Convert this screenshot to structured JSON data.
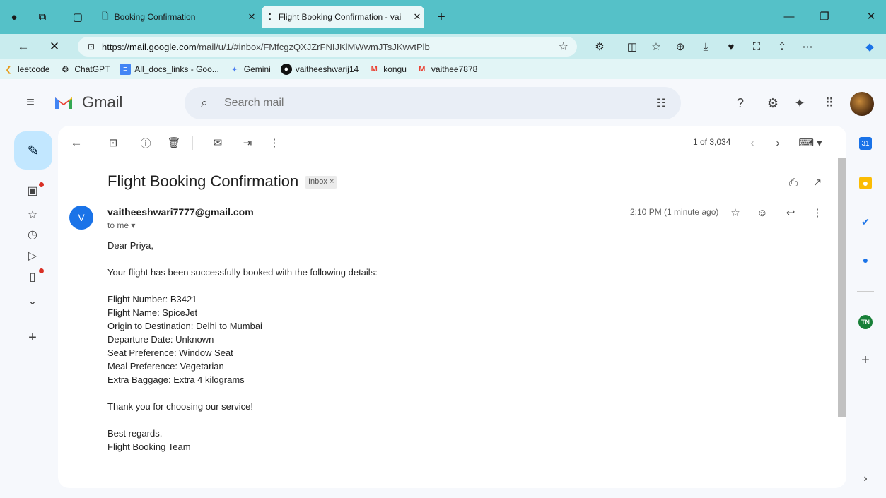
{
  "browser": {
    "tabs": [
      {
        "title": "Booking Confirmation"
      },
      {
        "title": "Flight Booking Confirmation - vai"
      }
    ],
    "new_tab": "+",
    "url_host": "https://mail.google.com",
    "url_rest": "/mail/u/1/#inbox/FMfcgzQXJZrFNIJKlMWwmJTsJKwvtPlb",
    "bookmarks": [
      {
        "label": "leetcode",
        "icon": "leetcode-icon"
      },
      {
        "label": "ChatGPT",
        "icon": "chatgpt-icon"
      },
      {
        "label": "All_docs_links - Goo...",
        "icon": "docs-icon"
      },
      {
        "label": "Gemini",
        "icon": "gemini-icon"
      },
      {
        "label": "vaitheeshwarij14",
        "icon": "github-icon"
      },
      {
        "label": "kongu",
        "icon": "gmail-icon"
      },
      {
        "label": "vaithee7878",
        "icon": "gmail-icon"
      }
    ]
  },
  "gmail": {
    "app_name": "Gmail",
    "search_placeholder": "Search mail"
  },
  "toolbar": {
    "count": "1 of 3,034"
  },
  "email": {
    "subject": "Flight Booking Confirmation",
    "label": "Inbox ×",
    "sender_initial": "V",
    "sender": "vaitheeshwari7777@gmail.com",
    "to": "to me ▾",
    "time": "2:10 PM (1 minute ago)",
    "body": {
      "greeting": "Dear Priya,",
      "intro": "Your flight has been successfully booked with the following details:",
      "details": [
        "Flight Number: B3421",
        "Flight Name: SpiceJet",
        "Origin to Destination: Delhi to Mumbai",
        "Departure Date: Unknown",
        "Seat Preference: Window Seat",
        "Meal Preference: Vegetarian",
        "Extra Baggage: Extra 4 kilograms"
      ],
      "thanks": "Thank you for choosing our service!",
      "signoff": "Best regards,",
      "signature": "Flight Booking Team"
    }
  },
  "colors": {
    "tabbar": "#55c1c8",
    "compose": "#c2e7ff",
    "sender_avatar": "#1a73e8",
    "notification_dot": "#d93025"
  }
}
